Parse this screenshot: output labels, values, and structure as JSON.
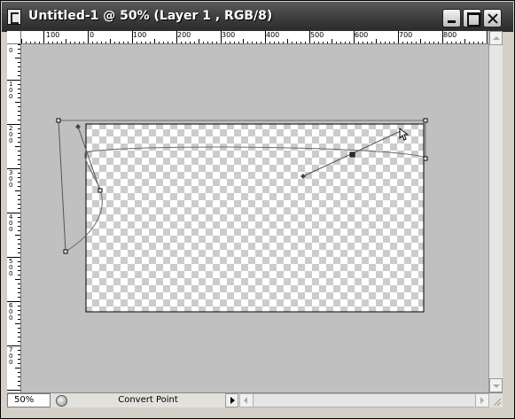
{
  "window": {
    "title": "Untitled-1 @ 50% (Layer 1 , RGB/8)",
    "title_icon": "photoshop-document-icon"
  },
  "title_buttons": {
    "minimize_icon": "minimize-icon",
    "maximize_icon": "maximize-icon",
    "close_icon": "close-icon"
  },
  "ruler_top": {
    "labels": [
      "100",
      "0",
      "100",
      "200",
      "300",
      "400",
      "500",
      "600",
      "700",
      "800"
    ]
  },
  "ruler_left": {
    "labels": [
      "0",
      "100",
      "200",
      "300",
      "400",
      "500",
      "600",
      "700"
    ]
  },
  "canvas": {
    "background_color": "#c0c0c0",
    "document": "transparent layer (checkerboard)",
    "tool": "pen-path"
  },
  "status_bar": {
    "zoom": "50%",
    "info_icon": "document-info-icon",
    "status_text": "Convert Point",
    "menu_arrow_icon": "triangle-right-icon"
  },
  "colors": {
    "titlebar": "#3c3c3c",
    "window_face": "#d4d0c8",
    "pasteboard": "#c0c0c0"
  }
}
